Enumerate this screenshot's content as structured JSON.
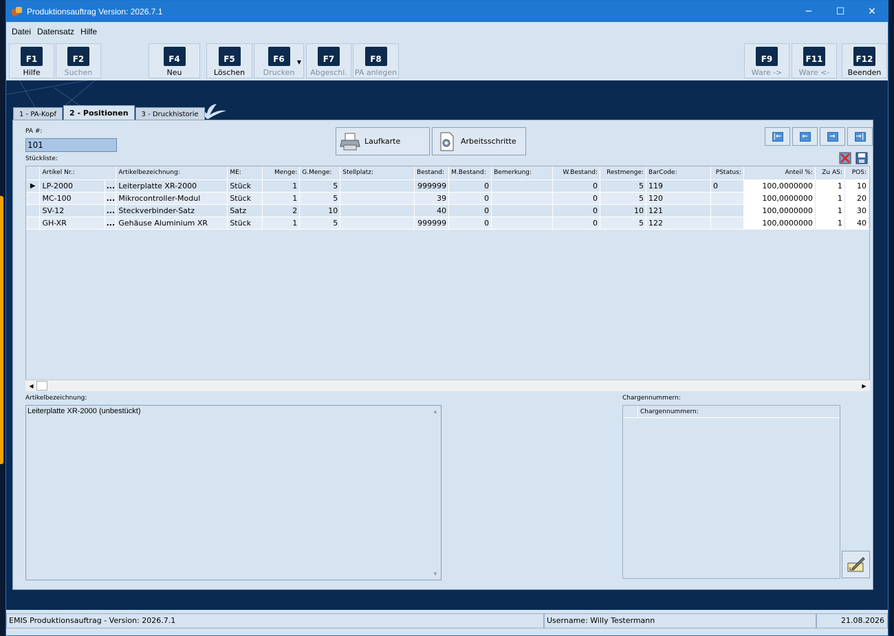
{
  "window": {
    "title": "Produktionsauftrag Version: 2026.7.1",
    "controls": {
      "minimize": "─",
      "maximize": "☐",
      "close": "✕"
    }
  },
  "menu": [
    "Datei",
    "Datensatz",
    "Hilfe"
  ],
  "toolbar": {
    "buttons": [
      {
        "key": "F1",
        "label": "Hilfe",
        "enabled": true
      },
      {
        "key": "F2",
        "label": "Suchen",
        "enabled": false
      },
      {
        "key": "F4",
        "label": "Neu",
        "enabled": true
      },
      {
        "key": "F5",
        "label": "Löschen",
        "enabled": true
      },
      {
        "key": "F6",
        "label": "Drucken",
        "enabled": false
      },
      {
        "key": "F7",
        "label": "Abgeschl.",
        "enabled": false
      },
      {
        "key": "F8",
        "label": "PA anlegen",
        "enabled": false
      },
      {
        "key": "F9",
        "label": "Ware ->",
        "enabled": false
      },
      {
        "key": "F11",
        "label": "Ware <-",
        "enabled": false
      },
      {
        "key": "F12",
        "label": "Beenden",
        "enabled": true
      }
    ]
  },
  "tabs": [
    {
      "label": "1 - PA-Kopf",
      "active": false
    },
    {
      "label": "2 - Positionen",
      "active": true
    },
    {
      "label": "3 - Druckhistorie",
      "active": false
    }
  ],
  "form": {
    "pa_label": "PA #:",
    "pa_value": "101",
    "stueckliste_label": "Stückliste:",
    "laufkarte_label": "Laufkarte",
    "arbeitsschritte_label": "Arbeitsschritte"
  },
  "grid": {
    "columns": [
      "Artikel Nr.:",
      "Artikelbezeichnung:",
      "ME:",
      "Menge:",
      "G.Menge:",
      "Stellplatz:",
      "Bestand:",
      "M.Bestand:",
      "Bemerkung:",
      "W.Bestand:",
      "Restmenge:",
      "BarCode:",
      "PStatus:",
      "Anteil %:",
      "Zu AS:",
      "POS:"
    ],
    "rows": [
      {
        "artikel_nr": "LP-2000",
        "bezeichnung": "Leiterplatte XR-2000",
        "me": "Stück",
        "menge": "1",
        "g_menge": "5",
        "stellplatz": "",
        "bestand": "999999",
        "m_bestand": "0",
        "bemerkung": "",
        "w_bestand": "0",
        "restmenge": "5",
        "barcode": "119",
        "pstatus": "0",
        "anteil": "100,0000000",
        "zu_as": "1",
        "pos": "10"
      },
      {
        "artikel_nr": "MC-100",
        "bezeichnung": "Mikrocontroller-Modul",
        "me": "Stück",
        "menge": "1",
        "g_menge": "5",
        "stellplatz": "",
        "bestand": "39",
        "m_bestand": "0",
        "bemerkung": "",
        "w_bestand": "0",
        "restmenge": "5",
        "barcode": "120",
        "pstatus": "",
        "anteil": "100,0000000",
        "zu_as": "1",
        "pos": "20"
      },
      {
        "artikel_nr": "SV-12",
        "bezeichnung": "Steckverbinder-Satz",
        "me": "Satz",
        "menge": "2",
        "g_menge": "10",
        "stellplatz": "",
        "bestand": "40",
        "m_bestand": "0",
        "bemerkung": "",
        "w_bestand": "0",
        "restmenge": "10",
        "barcode": "121",
        "pstatus": "",
        "anteil": "100,0000000",
        "zu_as": "1",
        "pos": "30"
      },
      {
        "artikel_nr": "GH-XR",
        "bezeichnung": "Gehäuse Aluminium XR",
        "me": "Stück",
        "menge": "1",
        "g_menge": "5",
        "stellplatz": "",
        "bestand": "999999",
        "m_bestand": "0",
        "bemerkung": "",
        "w_bestand": "0",
        "restmenge": "5",
        "barcode": "122",
        "pstatus": "",
        "anteil": "100,0000000",
        "zu_as": "1",
        "pos": "40"
      }
    ],
    "row_button": "...",
    "row_indicator": "▶"
  },
  "detail": {
    "artikelbezeichnung_label": "Artikelbezeichnung:",
    "artikelbezeichnung_value": "Leiterplatte XR-2000 (unbestückt)",
    "chargen_label": "Chargennummern:",
    "chargen_column": "Chargennummern:"
  },
  "statusbar": {
    "app": "EMIS Produktionsauftrag - Version: 2026.7.1",
    "user": "Username: Willy Testermann",
    "date": "21.08.2026"
  },
  "colors": {
    "titlebar": "#1f78d1",
    "background": "#d6e3f0",
    "dark_bg": "#0a2a52",
    "key_cap": "#0d2b4e"
  }
}
